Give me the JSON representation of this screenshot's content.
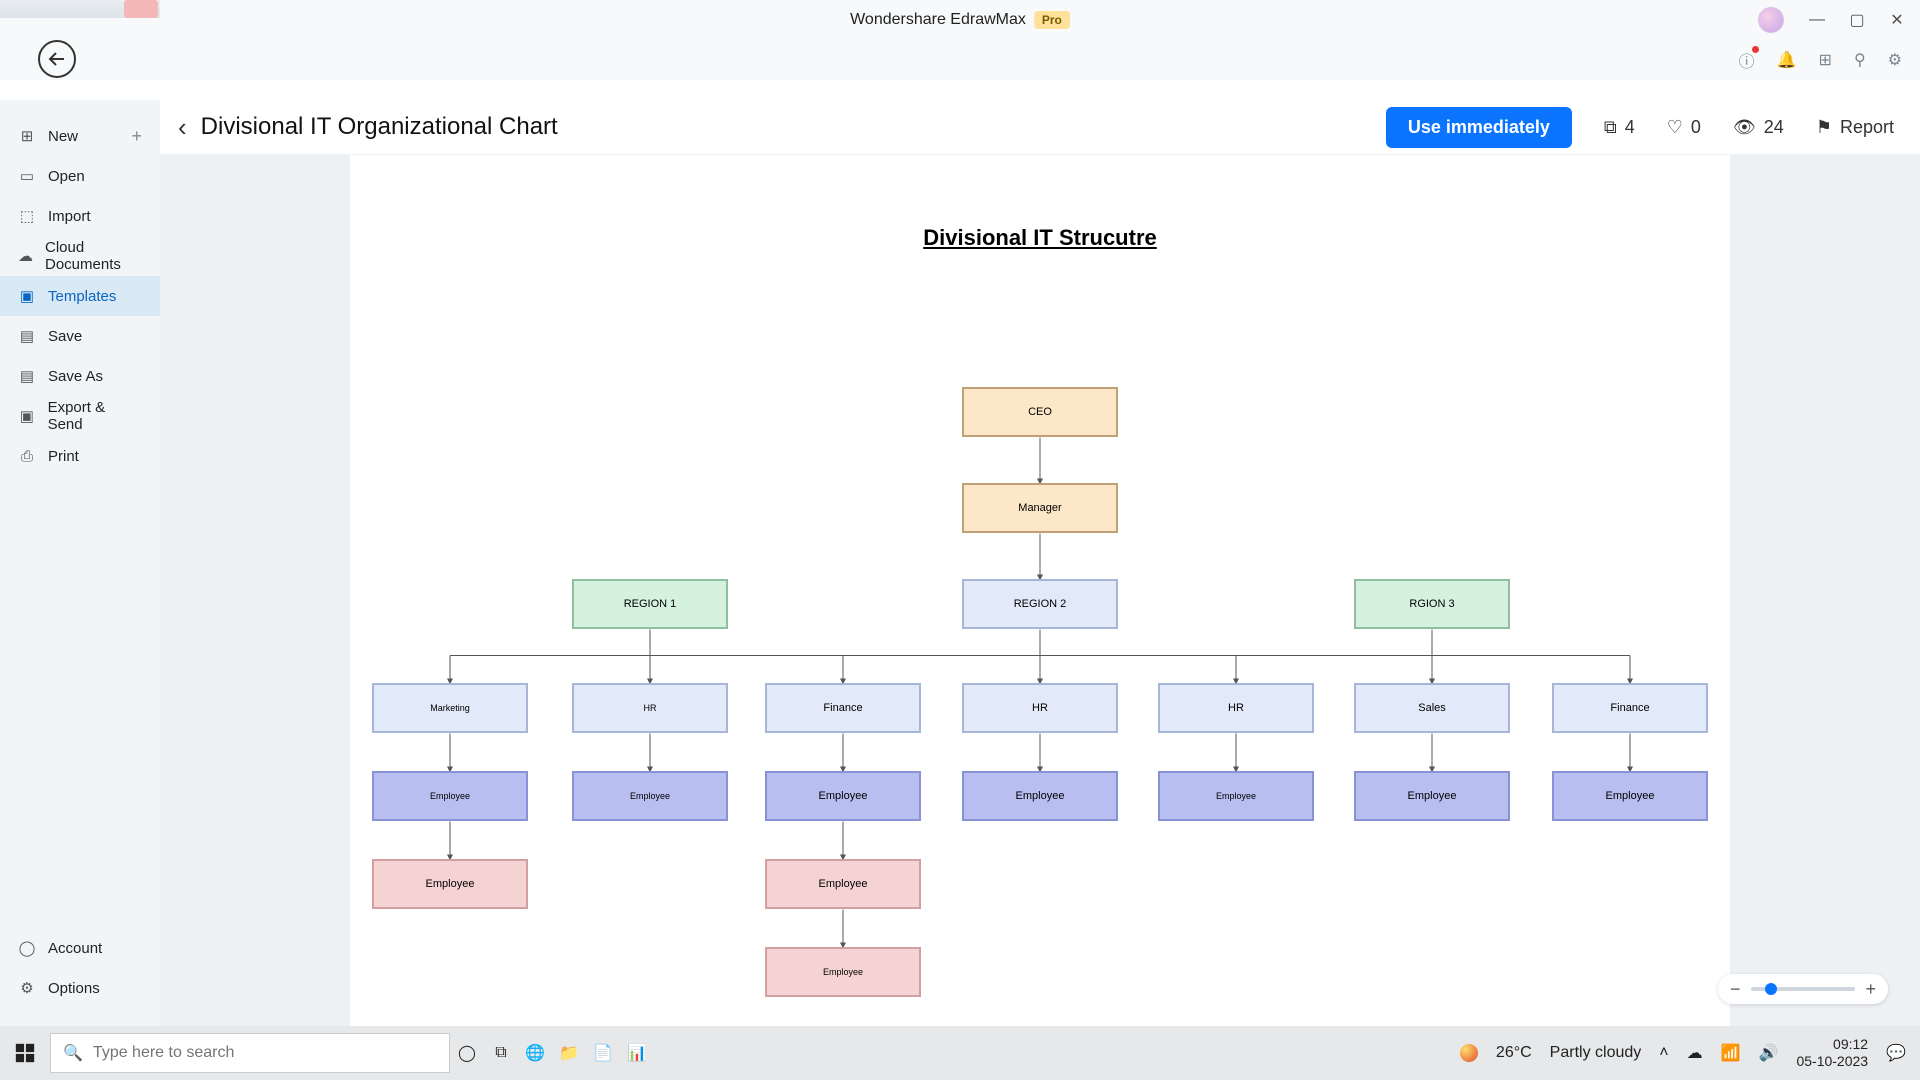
{
  "os": {
    "search_placeholder": "Type here to search",
    "weather_temp": "26°C",
    "weather_text": "Partly cloudy",
    "clock_time": "09:12",
    "clock_date": "05-10-2023"
  },
  "app": {
    "name": "Wondershare EdrawMax",
    "pro_badge": "Pro"
  },
  "sidebar": {
    "items": [
      {
        "icon": "plus-square",
        "label": "New",
        "has_plus": true
      },
      {
        "icon": "folder",
        "label": "Open"
      },
      {
        "icon": "inbox",
        "label": "Import"
      },
      {
        "icon": "cloud",
        "label": "Cloud Documents"
      },
      {
        "icon": "template",
        "label": "Templates",
        "active": true
      },
      {
        "icon": "save",
        "label": "Save"
      },
      {
        "icon": "save",
        "label": "Save As"
      },
      {
        "icon": "briefcase",
        "label": "Export & Send"
      },
      {
        "icon": "printer",
        "label": "Print"
      }
    ],
    "bottom": [
      {
        "icon": "user",
        "label": "Account"
      },
      {
        "icon": "gear",
        "label": "Options"
      }
    ]
  },
  "page": {
    "title": "Divisional IT Organizational Chart",
    "use_label": "Use immediately",
    "copies": "4",
    "likes": "0",
    "views": "24",
    "report_label": "Report"
  },
  "diagram": {
    "title": "Divisional IT Strucutre",
    "nodes": {
      "ceo": "CEO",
      "mgr": "Manager",
      "r1": "REGION 1",
      "r2": "REGION 2",
      "r3": "RGION 3",
      "d1": "Marketing",
      "d2": "HR",
      "d3": "Finance",
      "d4": "HR",
      "d5": "HR",
      "d6": "Sales",
      "d7": "Finance",
      "e1": "Employee",
      "e2": "Employee",
      "e3": "Employee",
      "e4": "Employee",
      "e5": "Employee",
      "e6": "Employee",
      "e7": "Employee",
      "e8": "Employee",
      "e9": "Employee",
      "e10": "Employee"
    }
  }
}
